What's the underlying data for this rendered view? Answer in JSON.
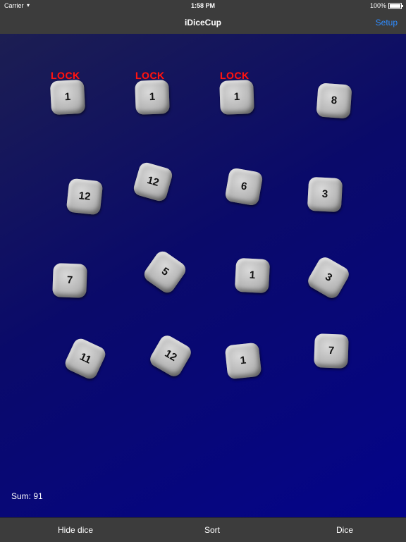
{
  "status": {
    "carrier": "Carrier",
    "wifi_icon": "wifi-icon",
    "time": "1:58 PM",
    "battery": "100%",
    "battery_level": 1.0
  },
  "nav": {
    "title": "iDiceCup",
    "setup_label": "Setup",
    "setup_color": "#2f8cff"
  },
  "lock_label": "LOCK",
  "dice": [
    {
      "value": "1",
      "locked": true
    },
    {
      "value": "1",
      "locked": true
    },
    {
      "value": "1",
      "locked": true
    },
    {
      "value": "8",
      "locked": false
    },
    {
      "value": "12",
      "locked": false
    },
    {
      "value": "12",
      "locked": false
    },
    {
      "value": "6",
      "locked": false
    },
    {
      "value": "3",
      "locked": false
    },
    {
      "value": "7",
      "locked": false
    },
    {
      "value": "5",
      "locked": false
    },
    {
      "value": "1",
      "locked": false
    },
    {
      "value": "3",
      "locked": false
    },
    {
      "value": "11",
      "locked": false
    },
    {
      "value": "12",
      "locked": false
    },
    {
      "value": "1",
      "locked": false
    },
    {
      "value": "7",
      "locked": false
    }
  ],
  "sum_text": "Sum: 91",
  "toolbar": {
    "hide_label": "Hide dice",
    "sort_label": "Sort",
    "dice_label": "Dice"
  }
}
